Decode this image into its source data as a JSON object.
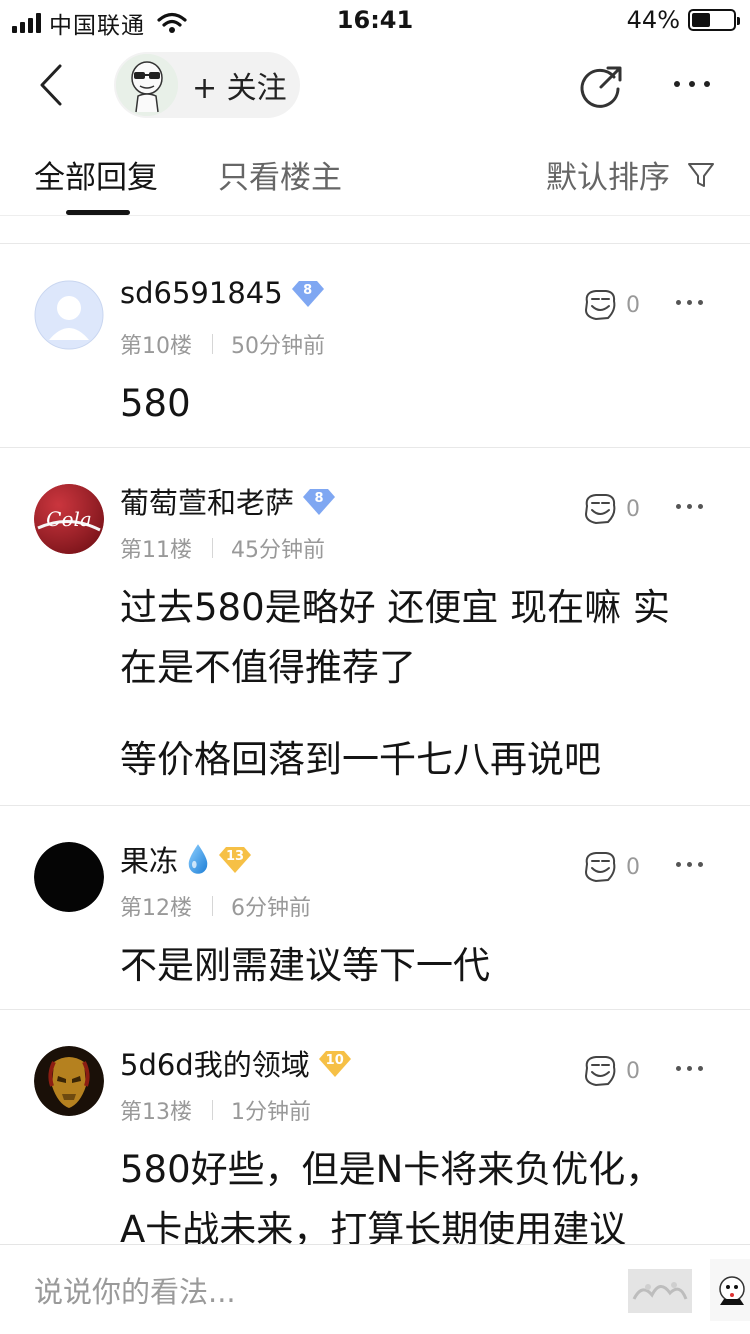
{
  "status_bar": {
    "carrier": "中国联通",
    "time": "16:41",
    "battery": "44%",
    "battery_level": 0.44
  },
  "nav": {
    "follow_label": "+ 关注"
  },
  "tabs": {
    "all_replies": "全部回复",
    "only_op": "只看楼主",
    "sort_label": "默认排序"
  },
  "comments": [
    {
      "username": "sd6591845",
      "level": "8",
      "level_color": "#7fa7f2",
      "floor": "第10楼",
      "time": "50分钟前",
      "likes": "0",
      "lines": [
        "580"
      ]
    },
    {
      "username": "葡萄萱和老萨",
      "level": "8",
      "level_color": "#7fa7f2",
      "floor": "第11楼",
      "time": "45分钟前",
      "likes": "0",
      "lines": [
        "过去580是略好 还便宜 现在嘛 实",
        "在是不值得推荐了",
        "等价格回落到一千七八再说吧"
      ]
    },
    {
      "username": "果冻",
      "level": "13",
      "level_color": "#f6c046",
      "floor": "第12楼",
      "time": "6分钟前",
      "likes": "0",
      "lines": [
        "不是刚需建议等下一代"
      ]
    },
    {
      "username": "5d6d我的领域",
      "level": "10",
      "level_color": "#f6c046",
      "floor": "第13楼",
      "time": "1分钟前",
      "likes": "0",
      "lines": [
        "580好些，但是N卡将来负优化，",
        "A卡战未来，打算长期使用建议"
      ]
    }
  ],
  "bottom_bar": {
    "placeholder": "说说你的看法..."
  },
  "icons": [
    "back-icon",
    "share-icon",
    "more-icon",
    "filter-icon",
    "like-icon",
    "water-drop-icon",
    "emoji-icon",
    "sticker-icon"
  ]
}
